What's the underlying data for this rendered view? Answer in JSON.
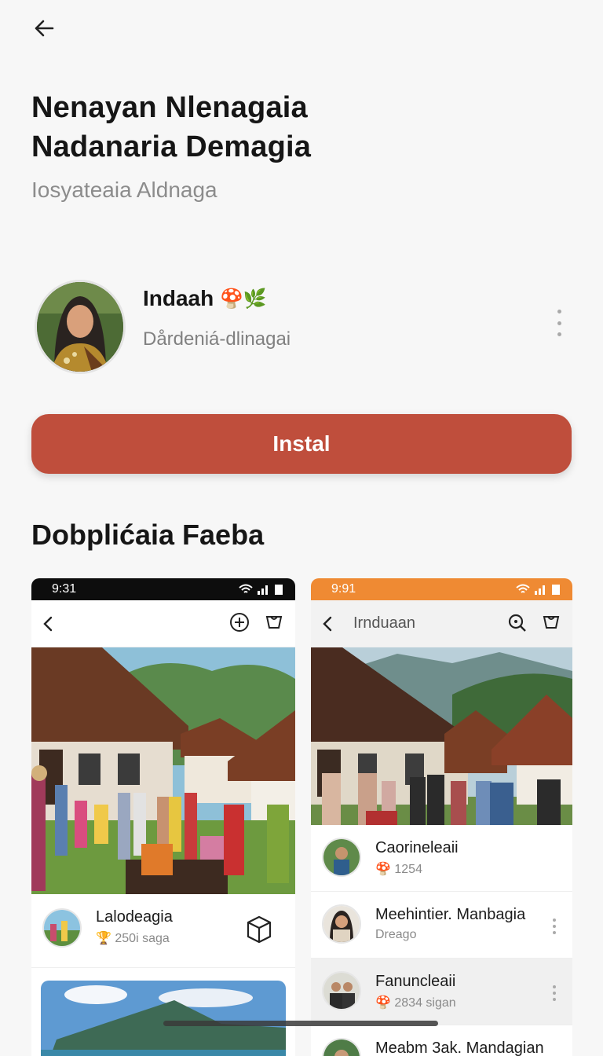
{
  "header": {
    "title_line1": "Nenayan Nlenagaia",
    "title_line2": "Nadanaria Demagia",
    "subtitle": "Iosyateaia Aldnaga"
  },
  "author": {
    "name": "Indaah",
    "emoji": "🍄🌿",
    "handle": "Dårdeniá-dlinagai"
  },
  "install_label": "Instal",
  "section_title": "Dobplićaia Faeba",
  "screens": {
    "left": {
      "time": "9:31",
      "card": {
        "title": "Lalodeagia",
        "meta": "250i saga"
      }
    },
    "right": {
      "time": "9:91",
      "nav_title": "Irnduaan",
      "items": [
        {
          "title": "Caorineleaii",
          "meta": "1254"
        },
        {
          "title": "Meehintier. Manbagia",
          "meta": "Dreago"
        },
        {
          "title": "Fanuncleaii",
          "meta": "2834 sigan"
        },
        {
          "title": "Meabm 3ak. Mandagian",
          "meta": ""
        }
      ]
    }
  },
  "colors": {
    "accent": "#bf4e3c",
    "status_orange": "#ef8a33",
    "background": "#f7f7f7"
  }
}
